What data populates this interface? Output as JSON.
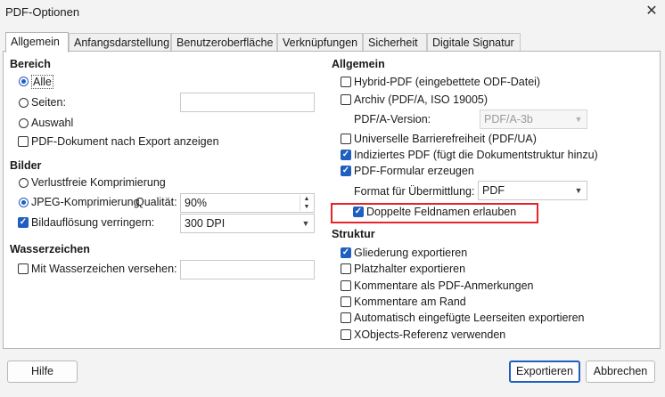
{
  "window": {
    "title": "PDF-Optionen",
    "close_glyph": "✕"
  },
  "tabs": [
    "Allgemein",
    "Anfangsdarstellung",
    "Benutzeroberfläche",
    "Verknüpfungen",
    "Sicherheit",
    "Digitale Signatur"
  ],
  "range": {
    "header": "Bereich",
    "all": "Alle",
    "pages": "Seiten:",
    "selection": "Auswahl",
    "export_notes": "PDF-Dokument nach Export anzeigen"
  },
  "images": {
    "header": "Bilder",
    "lossless": "Verlustfreie Komprimierung",
    "jpeg": "JPEG-Komprimierung",
    "quality_label": "Qualität:",
    "quality_value": "90%",
    "reduce": "Bildauflösung verringern:",
    "dpi_value": "300 DPI"
  },
  "watermark": {
    "header": "Wasserzeichen",
    "sign": "Mit Wasserzeichen versehen:"
  },
  "general": {
    "header": "Allgemein",
    "hybrid": "Hybrid-PDF (eingebettete ODF-Datei)",
    "archive": "Archiv (PDF/A, ISO 19005)",
    "pdfa_label": "PDF/A-Version:",
    "pdfa_value": "PDF/A-3b",
    "accessibility": "Universelle Barrierefreiheit (PDF/UA)",
    "tagged": "Indiziertes PDF (fügt die Dokumentstruktur hinzu)",
    "form": "PDF-Formular erzeugen",
    "submit_label": "Format für Übermittlung:",
    "submit_value": "PDF",
    "duplicate": "Doppelte Feldnamen erlauben"
  },
  "structure": {
    "header": "Struktur",
    "bookmarks": "Gliederung exportieren",
    "placeholders": "Platzhalter exportieren",
    "comments": "Kommentare als PDF-Anmerkungen",
    "comments_margin": "Kommentare am Rand",
    "blank_pages": "Automatisch eingefügte Leerseiten exportieren",
    "xobjects": "XObjects-Referenz verwenden"
  },
  "buttons": {
    "help": "Hilfe",
    "export": "Exportieren",
    "cancel": "Abbrechen"
  },
  "colors": {
    "accent": "#1f5fbf",
    "highlight": "#e3262a"
  },
  "icons": {
    "close": "close-icon",
    "checkmark": "checkmark-icon",
    "dropdown": "chevron-down-icon"
  }
}
